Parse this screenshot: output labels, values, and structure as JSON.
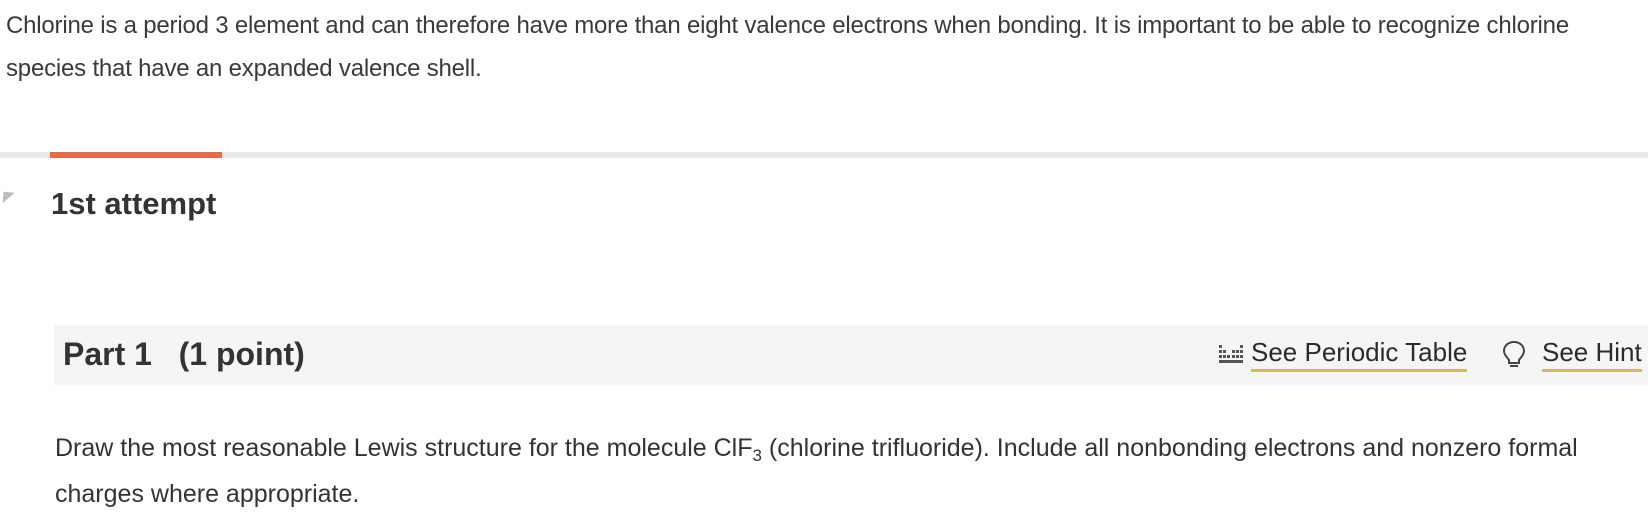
{
  "intro": {
    "line1": "Chlorine is a period 3 element and can therefore have more than eight valence electrons when bonding. It is important to be able to recognize chlorine",
    "line2": "species that have an expanded valence shell."
  },
  "attempt": {
    "title": "1st attempt"
  },
  "part": {
    "title": "Part 1   (1 point)",
    "periodic_link": "See Periodic Table",
    "hint_link": "See Hint"
  },
  "question": {
    "text_before": "Draw the most reasonable Lewis structure for the molecule ClF",
    "subscript": "3",
    "text_after": " (chlorine trifluoride). Include all nonbonding electrons and nonzero formal charges where appropriate."
  },
  "colors": {
    "accent": "#e8694a",
    "link_underline": "#e0b64a",
    "header_bg": "#f5f5f5"
  },
  "icons": {
    "periodic": "periodic-table-icon",
    "hint": "lightbulb-icon",
    "collapse": "caret-icon"
  }
}
